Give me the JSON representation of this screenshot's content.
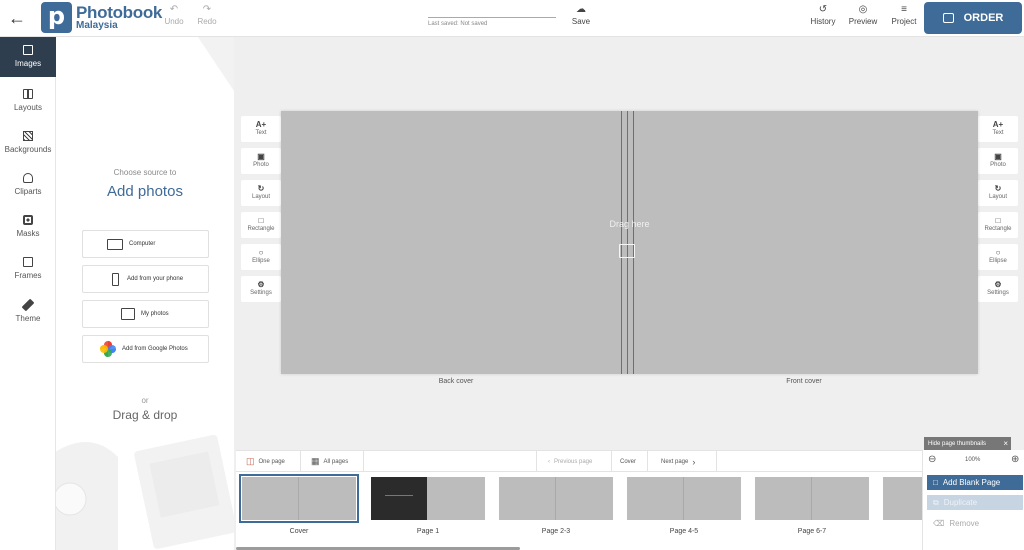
{
  "header": {
    "back_icon": "arrow-left-icon",
    "logo_letter": "p",
    "logo_title": "Photobook",
    "logo_subtitle": "Malaysia",
    "undo": "Undo",
    "redo": "Redo",
    "last_saved_label": "Last saved:",
    "last_saved_value": "Not saved",
    "save": "Save",
    "history": "History",
    "preview": "Preview",
    "project": "Project",
    "order": "ORDER",
    "brand_color": "#3f6b98"
  },
  "nav": {
    "items": [
      {
        "label": "Images",
        "icon": "images-icon"
      },
      {
        "label": "Layouts",
        "icon": "layouts-icon"
      },
      {
        "label": "Backgrounds",
        "icon": "backgrounds-icon"
      },
      {
        "label": "Cliparts",
        "icon": "cliparts-icon"
      },
      {
        "label": "Masks",
        "icon": "masks-icon"
      },
      {
        "label": "Frames",
        "icon": "frames-icon"
      },
      {
        "label": "Theme",
        "icon": "theme-icon"
      }
    ],
    "active": "Images"
  },
  "panel": {
    "source_hint": "Choose source to",
    "title": "Add photos",
    "sources": [
      "Computer",
      "Add from your phone",
      "My photos",
      "Add from Google Photos"
    ],
    "or": "or",
    "drag_drop": "Drag & drop"
  },
  "tools": {
    "items": [
      "Text",
      "Photo",
      "Layout",
      "Rectangle",
      "Ellipse",
      "Settings"
    ]
  },
  "canvas": {
    "drag_here": "Drag here",
    "back_cover": "Back cover",
    "front_cover": "Front cover"
  },
  "pagination": {
    "one_page": "One page",
    "all_pages": "All pages",
    "previous": "Previous page",
    "current": "Cover",
    "next": "Next page"
  },
  "thumbnails": [
    "Cover",
    "Page 1",
    "Page 2-3",
    "Page 4-5",
    "Page 6-7"
  ],
  "right_panel": {
    "hide_thumbnails": "Hide page thumbnails",
    "zoom": "100%",
    "add_blank_page": "Add Blank Page",
    "duplicate": "Duplicate",
    "remove": "Remove"
  }
}
